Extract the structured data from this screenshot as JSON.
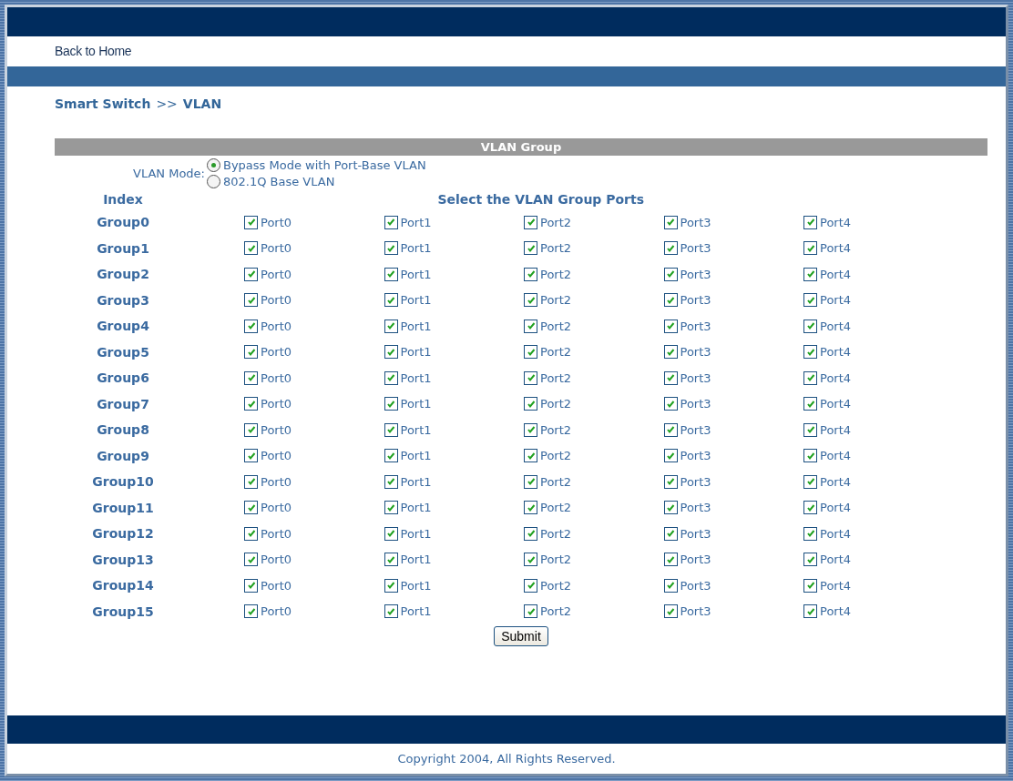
{
  "nav": {
    "link": "Back to Home"
  },
  "breadcrumb": {
    "site": "Smart Switch",
    "separator": ">>",
    "page": "VLAN"
  },
  "section_title": "VLAN Group",
  "vlan_mode": {
    "label": "VLAN Mode:",
    "options": [
      {
        "label": "Bypass Mode with Port-Base VLAN",
        "selected": true
      },
      {
        "label": "802.1Q Base VLAN",
        "selected": false
      }
    ]
  },
  "table": {
    "columns": [
      "Index",
      "Select the VLAN Group Ports"
    ],
    "rows": [
      {
        "group": "Group0",
        "ports": [
          {
            "label": "Port0",
            "checked": true
          },
          {
            "label": "Port1",
            "checked": true
          },
          {
            "label": "Port2",
            "checked": true
          },
          {
            "label": "Port3",
            "checked": true
          },
          {
            "label": "Port4",
            "checked": true
          }
        ]
      },
      {
        "group": "Group1",
        "ports": [
          {
            "label": "Port0",
            "checked": true
          },
          {
            "label": "Port1",
            "checked": true
          },
          {
            "label": "Port2",
            "checked": true
          },
          {
            "label": "Port3",
            "checked": true
          },
          {
            "label": "Port4",
            "checked": true
          }
        ]
      },
      {
        "group": "Group2",
        "ports": [
          {
            "label": "Port0",
            "checked": true
          },
          {
            "label": "Port1",
            "checked": true
          },
          {
            "label": "Port2",
            "checked": true
          },
          {
            "label": "Port3",
            "checked": true
          },
          {
            "label": "Port4",
            "checked": true
          }
        ]
      },
      {
        "group": "Group3",
        "ports": [
          {
            "label": "Port0",
            "checked": true
          },
          {
            "label": "Port1",
            "checked": true
          },
          {
            "label": "Port2",
            "checked": true
          },
          {
            "label": "Port3",
            "checked": true
          },
          {
            "label": "Port4",
            "checked": true
          }
        ]
      },
      {
        "group": "Group4",
        "ports": [
          {
            "label": "Port0",
            "checked": true
          },
          {
            "label": "Port1",
            "checked": true
          },
          {
            "label": "Port2",
            "checked": true
          },
          {
            "label": "Port3",
            "checked": true
          },
          {
            "label": "Port4",
            "checked": true
          }
        ]
      },
      {
        "group": "Group5",
        "ports": [
          {
            "label": "Port0",
            "checked": true
          },
          {
            "label": "Port1",
            "checked": true
          },
          {
            "label": "Port2",
            "checked": true
          },
          {
            "label": "Port3",
            "checked": true
          },
          {
            "label": "Port4",
            "checked": true
          }
        ]
      },
      {
        "group": "Group6",
        "ports": [
          {
            "label": "Port0",
            "checked": true
          },
          {
            "label": "Port1",
            "checked": true
          },
          {
            "label": "Port2",
            "checked": true
          },
          {
            "label": "Port3",
            "checked": true
          },
          {
            "label": "Port4",
            "checked": true
          }
        ]
      },
      {
        "group": "Group7",
        "ports": [
          {
            "label": "Port0",
            "checked": true
          },
          {
            "label": "Port1",
            "checked": true
          },
          {
            "label": "Port2",
            "checked": true
          },
          {
            "label": "Port3",
            "checked": true
          },
          {
            "label": "Port4",
            "checked": true
          }
        ]
      },
      {
        "group": "Group8",
        "ports": [
          {
            "label": "Port0",
            "checked": true
          },
          {
            "label": "Port1",
            "checked": true
          },
          {
            "label": "Port2",
            "checked": true
          },
          {
            "label": "Port3",
            "checked": true
          },
          {
            "label": "Port4",
            "checked": true
          }
        ]
      },
      {
        "group": "Group9",
        "ports": [
          {
            "label": "Port0",
            "checked": true
          },
          {
            "label": "Port1",
            "checked": true
          },
          {
            "label": "Port2",
            "checked": true
          },
          {
            "label": "Port3",
            "checked": true
          },
          {
            "label": "Port4",
            "checked": true
          }
        ]
      },
      {
        "group": "Group10",
        "ports": [
          {
            "label": "Port0",
            "checked": true
          },
          {
            "label": "Port1",
            "checked": true
          },
          {
            "label": "Port2",
            "checked": true
          },
          {
            "label": "Port3",
            "checked": true
          },
          {
            "label": "Port4",
            "checked": true
          }
        ]
      },
      {
        "group": "Group11",
        "ports": [
          {
            "label": "Port0",
            "checked": true
          },
          {
            "label": "Port1",
            "checked": true
          },
          {
            "label": "Port2",
            "checked": true
          },
          {
            "label": "Port3",
            "checked": true
          },
          {
            "label": "Port4",
            "checked": true
          }
        ]
      },
      {
        "group": "Group12",
        "ports": [
          {
            "label": "Port0",
            "checked": true
          },
          {
            "label": "Port1",
            "checked": true
          },
          {
            "label": "Port2",
            "checked": true
          },
          {
            "label": "Port3",
            "checked": true
          },
          {
            "label": "Port4",
            "checked": true
          }
        ]
      },
      {
        "group": "Group13",
        "ports": [
          {
            "label": "Port0",
            "checked": true
          },
          {
            "label": "Port1",
            "checked": true
          },
          {
            "label": "Port2",
            "checked": true
          },
          {
            "label": "Port3",
            "checked": true
          },
          {
            "label": "Port4",
            "checked": true
          }
        ]
      },
      {
        "group": "Group14",
        "ports": [
          {
            "label": "Port0",
            "checked": true
          },
          {
            "label": "Port1",
            "checked": true
          },
          {
            "label": "Port2",
            "checked": true
          },
          {
            "label": "Port3",
            "checked": true
          },
          {
            "label": "Port4",
            "checked": true
          }
        ]
      },
      {
        "group": "Group15",
        "ports": [
          {
            "label": "Port0",
            "checked": true
          },
          {
            "label": "Port1",
            "checked": true
          },
          {
            "label": "Port2",
            "checked": true
          },
          {
            "label": "Port3",
            "checked": true
          },
          {
            "label": "Port4",
            "checked": true
          }
        ]
      }
    ]
  },
  "submit_button": "Submit",
  "footer": "Copyright 2004, All Rights Reserved."
}
